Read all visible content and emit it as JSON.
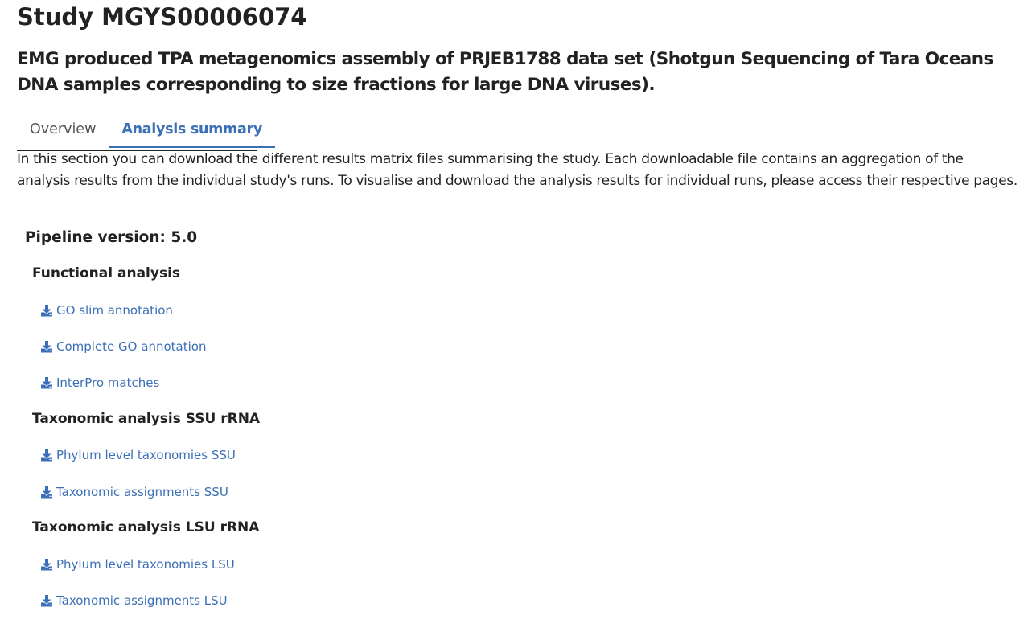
{
  "study": {
    "title": "Study MGYS00006074",
    "subtitle": "EMG produced TPA metagenomics assembly of PRJEB1788 data set (Shotgun Sequencing of Tara Oceans DNA samples corresponding to size fractions for large DNA viruses)."
  },
  "tabs": [
    {
      "label": "Overview",
      "active": false
    },
    {
      "label": "Analysis summary",
      "active": true
    }
  ],
  "intro": "In this section you can download the different results matrix files summarising the study. Each downloadable file contains an aggregation of the analysis results from the individual study's runs. To visualise and download the analysis results for individual runs, please access their respective pages.",
  "pipeline": {
    "label": "Pipeline version: 5.0"
  },
  "sections": [
    {
      "heading": "Functional analysis",
      "links": [
        "GO slim annotation",
        "Complete GO annotation",
        "InterPro matches"
      ]
    },
    {
      "heading": "Taxonomic analysis SSU rRNA",
      "links": [
        "Phylum level taxonomies SSU",
        "Taxonomic assignments SSU"
      ]
    },
    {
      "heading": "Taxonomic analysis LSU rRNA",
      "links": [
        "Phylum level taxonomies LSU",
        "Taxonomic assignments LSU"
      ]
    }
  ],
  "icons": {
    "download": "download-icon"
  },
  "colors": {
    "link": "#3b6fb6",
    "text": "#222222",
    "tab_inactive": "#555555"
  }
}
